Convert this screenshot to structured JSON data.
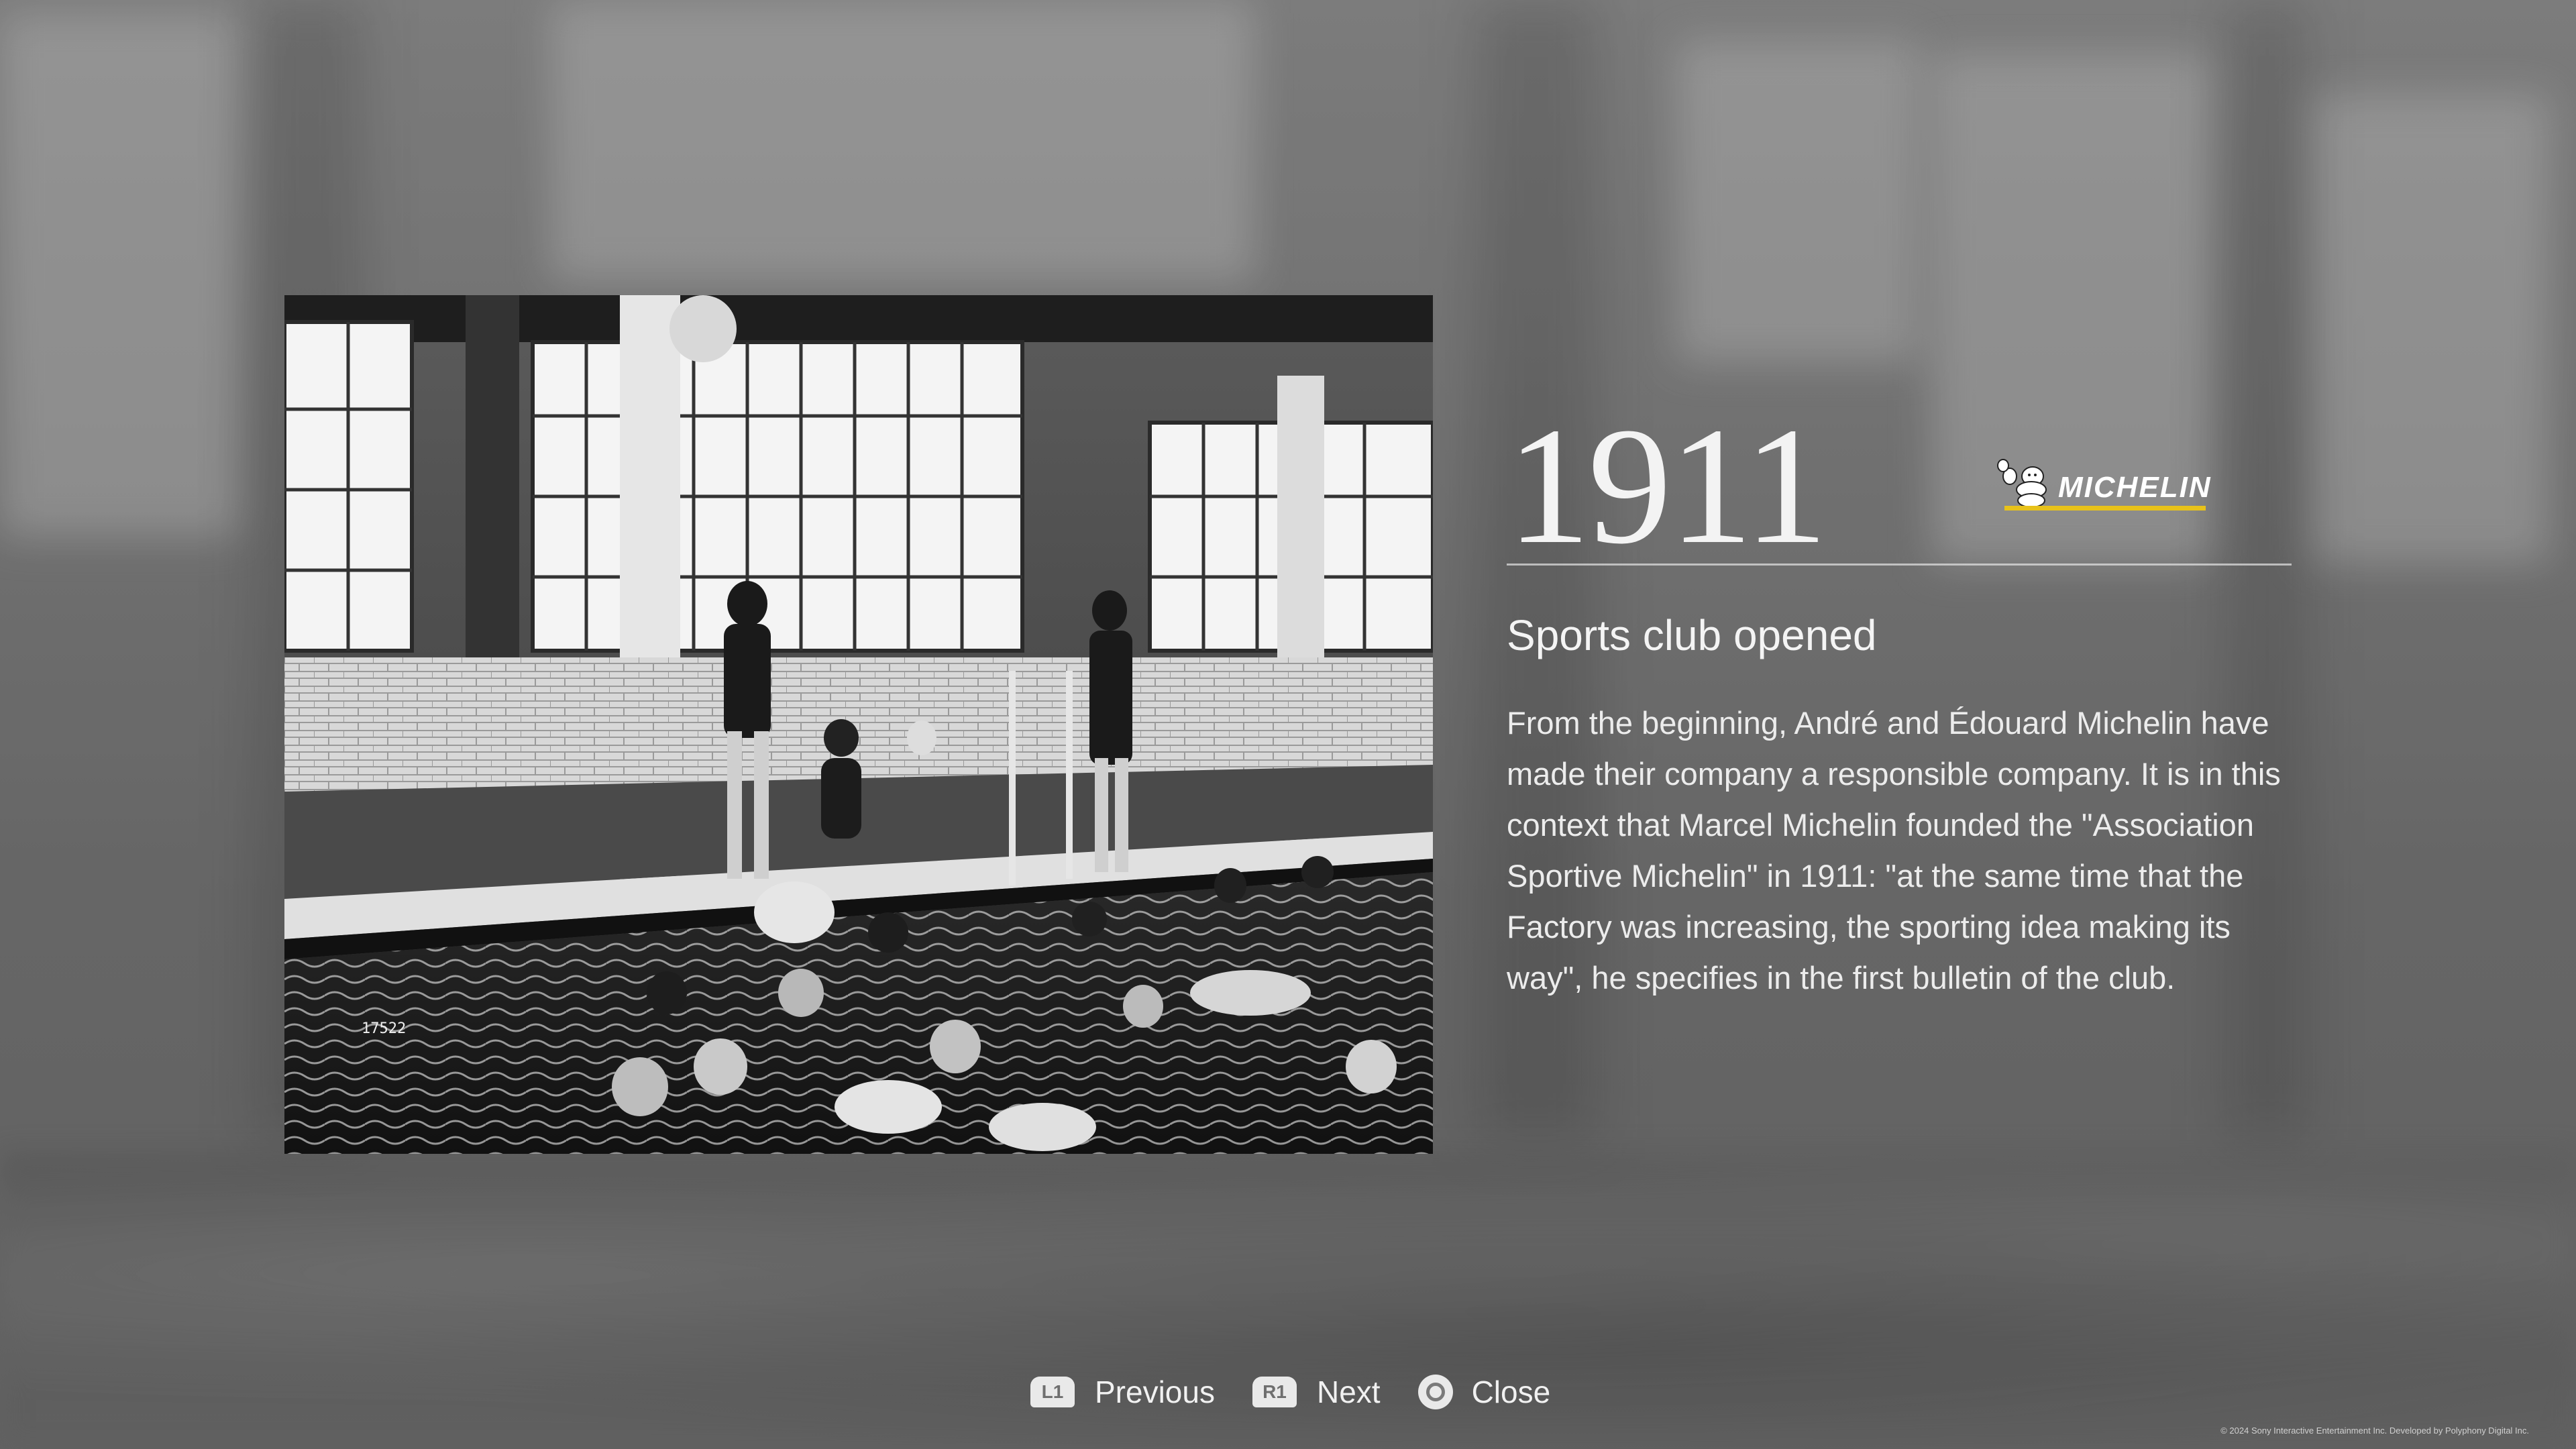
{
  "entry": {
    "year": "1911",
    "brand": "MICHELIN",
    "title": "Sports club opened",
    "description": "From the beginning, André and Édouard Michelin have made their company a responsible company. It is in this context that Marcel Michelin founded the \"Association Sportive Michelin\" in 1911: \"at the same time that the Factory was increasing, the sporting idea making its way\", he specifies in the first bulletin of the club.",
    "photo_caption_number": "17522"
  },
  "colors": {
    "brand_accent": "#e8c21a",
    "text": "#ececec"
  },
  "controls": [
    {
      "button": "L1",
      "label": "Previous",
      "icon": "l1-button-icon"
    },
    {
      "button": "R1",
      "label": "Next",
      "icon": "r1-button-icon"
    },
    {
      "button": "",
      "label": "Close",
      "icon": "circle-button-icon"
    }
  ],
  "footer": {
    "copyright": "© 2024 Sony Interactive Entertainment Inc. Developed by Polyphony Digital Inc."
  }
}
